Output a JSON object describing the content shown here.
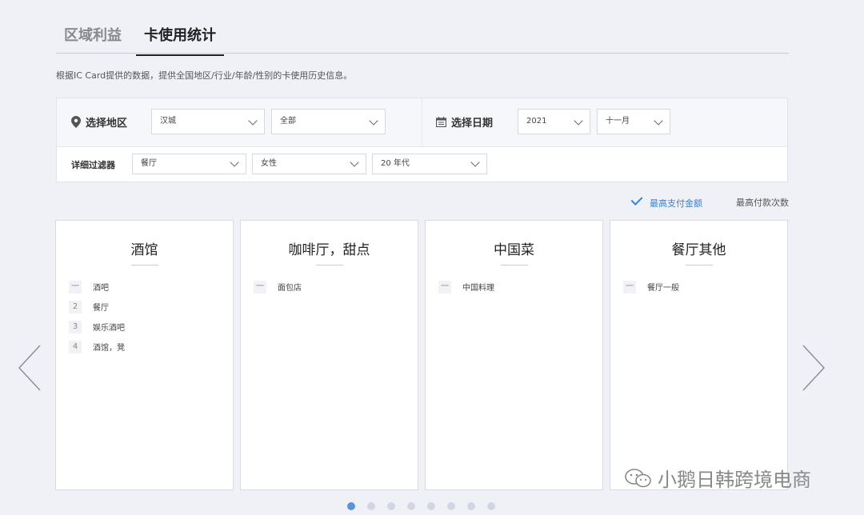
{
  "tabs": [
    {
      "label": "区域利益",
      "active": false
    },
    {
      "label": "卡使用统计",
      "active": true
    }
  ],
  "description": "根据IC Card提供的数据，提供全国地区/行业/年龄/性别的卡使用历史信息。",
  "filters": {
    "region_label": "选择地区",
    "region_value": "汉城",
    "district_value": "全部",
    "date_label": "选择日期",
    "year_value": "2021",
    "month_value": "十一月",
    "detail_label": "详细过滤器",
    "industry_value": "餐厅",
    "gender_value": "女性",
    "age_value": "20 年代"
  },
  "sort": {
    "active_label": "最高支付金额",
    "inactive_label": "最高付款次数"
  },
  "cards": [
    {
      "title": "酒馆",
      "items": [
        {
          "rank": "一",
          "name": "酒吧"
        },
        {
          "rank": "2",
          "name": "餐厅"
        },
        {
          "rank": "3",
          "name": "娱乐酒吧"
        },
        {
          "rank": "4",
          "name": "酒馆，凳"
        }
      ]
    },
    {
      "title": "咖啡厅，甜点",
      "items": [
        {
          "rank": "一",
          "name": "面包店"
        }
      ]
    },
    {
      "title": "中国菜",
      "items": [
        {
          "rank": "一",
          "name": "中国料理"
        }
      ]
    },
    {
      "title": "餐厅其他",
      "items": [
        {
          "rank": "一",
          "name": "餐厅一般"
        }
      ]
    }
  ],
  "pagination": {
    "total": 8,
    "current": 1
  },
  "watermark": "小鹅日韩跨境电商",
  "colors": {
    "accent": "#3b7fd1",
    "background": "#f0f1f7"
  }
}
